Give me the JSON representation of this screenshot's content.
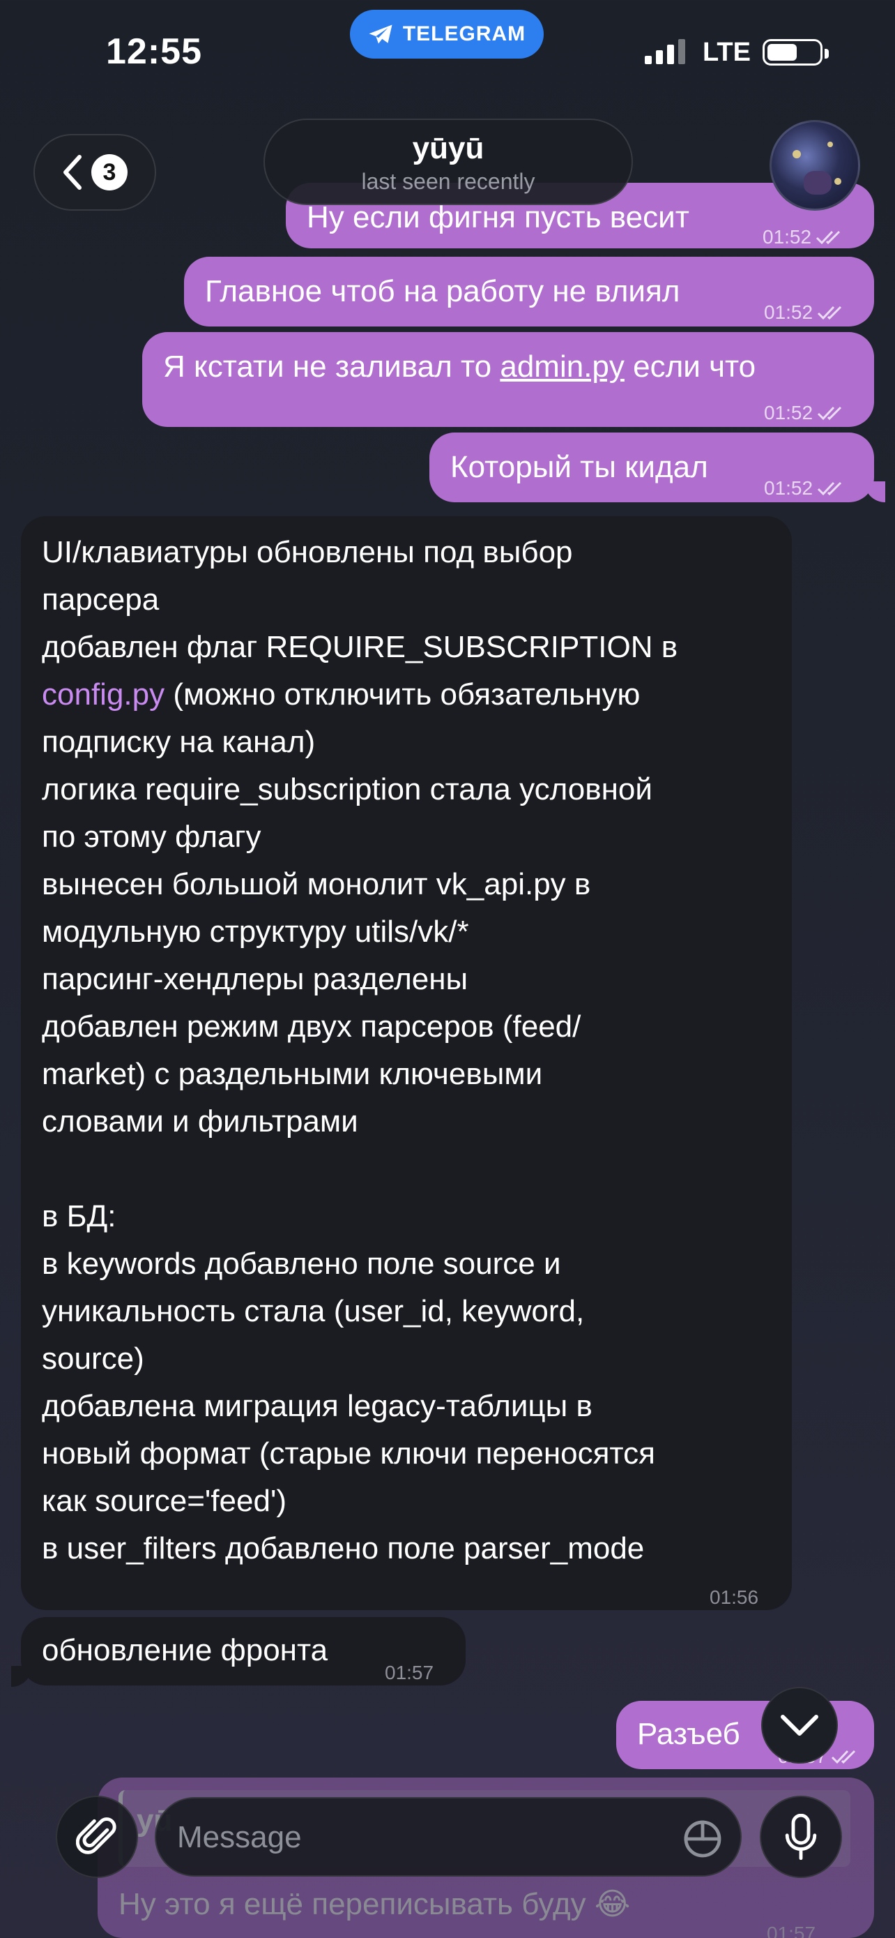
{
  "status_bar": {
    "time": "12:55",
    "app_pill": "TELEGRAM",
    "network": "LTE"
  },
  "header": {
    "back_badge": "3",
    "contact_name": "yūyū",
    "contact_status": "last seen recently"
  },
  "messages": {
    "m0": {
      "text": "Ну если фигня пусть весит",
      "time": "01:52"
    },
    "m1": {
      "text": "Главное чтоб на работу не влиял",
      "time": "01:52"
    },
    "m2": {
      "text_before": "Я кстати не заливал то ",
      "link": "admin.py",
      "text_after": " если что",
      "time": "01:52"
    },
    "m3": {
      "text": "Который ты кидал",
      "time": "01:52"
    },
    "m4": {
      "lines": {
        "l1": "UI/клавиатуры обновлены под выбор",
        "l2": "парсера",
        "l3": "добавлен флаг REQUIRE_SUBSCRIPTION в",
        "l4_link": "config.py",
        "l4_rest": " (можно отключить обязательную",
        "l5": "подписку на канал)",
        "l6": "логика require_subscription стала условной",
        "l7": "по этому флагу",
        "l8": "вынесен большой монолит vk_api.py в",
        "l9": "модульную структуру utils/vk/*",
        "l10": "парсинг-хендлеры разделены",
        "l11": "добавлен режим двух парсеров (feed/",
        "l12": "market) с раздельными ключевыми",
        "l13": "словами и фильтрами",
        "l14": "в БД:",
        "l15": "в keywords добавлено поле source и",
        "l16": "уникальность стала (user_id, keyword,",
        "l17": "source)",
        "l18": "добавлена миграция legacy-таблицы в",
        "l19": "новый формат (старые ключи переносятся",
        "l20": "как source='feed')",
        "l21": "в user_filters добавлено поле parser_mode"
      },
      "time": "01:56"
    },
    "m5": {
      "text": "обновление фронта",
      "time": "01:57"
    },
    "m6": {
      "text": "Разъеб",
      "time": "01:57"
    },
    "m7": {
      "reply_name": "yū",
      "text": "Ну это я ещё переписывать буду 😂",
      "time": "01:57"
    }
  },
  "composer": {
    "placeholder": "Message"
  },
  "colors": {
    "outgoing_bubble": "#b06fce",
    "incoming_bubble": "#1b1c21",
    "telegram_blue": "#2d7ff0",
    "link_purple": "#c98bf0"
  },
  "icons": [
    "telegram-icon",
    "back-chevron-icon",
    "double-check-icon",
    "chevron-down-icon",
    "paperclip-icon",
    "sticker-icon",
    "microphone-icon"
  ]
}
